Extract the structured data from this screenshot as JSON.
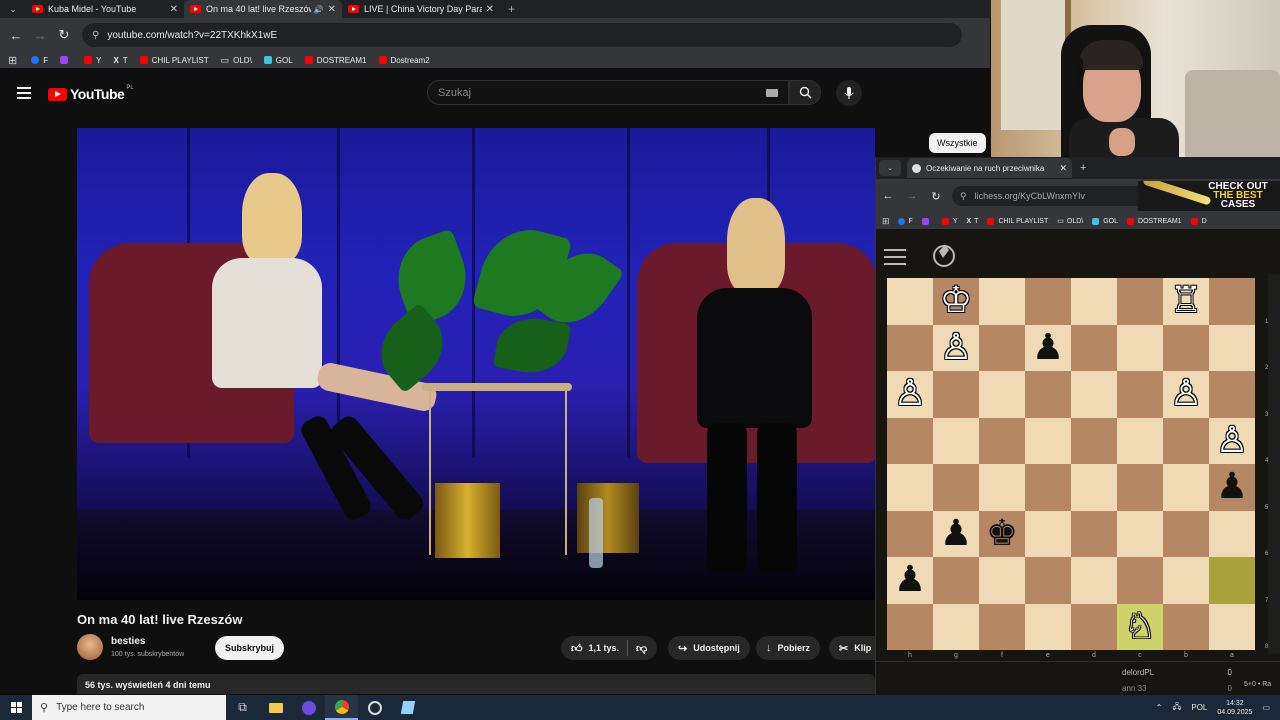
{
  "browser": {
    "tabs": [
      {
        "title": "Kuba Midel - YouTube",
        "active": false
      },
      {
        "title": "On ma 40 lat! live Rzeszów",
        "active": true
      },
      {
        "title": "LIVE | China Victory Day Parade",
        "active": false
      }
    ],
    "url": "youtube.com/watch?v=22TXKhkX1wE",
    "bookmarks": [
      {
        "label": "F",
        "color": "#1877f2"
      },
      {
        "label": "",
        "color": "#9146ff"
      },
      {
        "label": "Y",
        "color": "#ff0000"
      },
      {
        "label": "T",
        "color": "#ffffff"
      },
      {
        "label": "CHIL PLAYLIST",
        "color": "#ff0000"
      },
      {
        "label": "OLD\\",
        "color": "#888888"
      },
      {
        "label": "GOL",
        "color": "#3cc3e6"
      },
      {
        "label": "DOSTREAM1",
        "color": "#ff0000"
      },
      {
        "label": "Dostream2",
        "color": "#ff0000"
      }
    ]
  },
  "youtube": {
    "logo_text": "YouTube",
    "region": "PL",
    "search_placeholder": "Szukaj",
    "video_title": "On ma 40 lat! live Rzeszów",
    "channel_name": "besties",
    "channel_subs": "100 tys. subskrybentów",
    "subscribe_label": "Subskrybuj",
    "likes": "1,1 tys.",
    "share_label": "Udostępnij",
    "download_label": "Pobierz",
    "clip_label": "Klip",
    "views_line": "56 tys. wyświetleń  4 dni temu",
    "filter_chip": "Wszystkie"
  },
  "lichess": {
    "tab_title": "Oczekiwanie na ruch przeciwnika",
    "url": "lichess.org/KyCbLWnxmYIv",
    "ad_line1": "CHECK OUT",
    "ad_line2": "THE BEST",
    "ad_line3": "CASES",
    "bookmarks": [
      {
        "label": "F",
        "color": "#1877f2"
      },
      {
        "label": "",
        "color": "#9146ff"
      },
      {
        "label": "Y",
        "color": "#ff0000"
      },
      {
        "label": "T",
        "color": "#ffffff"
      },
      {
        "label": "CHIL PLAYLIST",
        "color": "#ff0000"
      },
      {
        "label": "OLD\\",
        "color": "#888888"
      },
      {
        "label": "GOL",
        "color": "#3cc3e6"
      },
      {
        "label": "DOSTREAM1",
        "color": "#ff0000"
      },
      {
        "label": "D",
        "color": "#ff0000"
      }
    ],
    "board": [
      [
        "",
        "wK",
        "",
        "",
        "",
        "",
        "wR",
        ""
      ],
      [
        "",
        "wP",
        "",
        "bP",
        "",
        "",
        "",
        ""
      ],
      [
        "wP",
        "",
        "",
        "",
        "",
        "",
        "wP",
        ""
      ],
      [
        "",
        "",
        "",
        "",
        "",
        "",
        "",
        "wP"
      ],
      [
        "",
        "",
        "",
        "",
        "",
        "",
        "",
        "bP"
      ],
      [
        "",
        "bP",
        "bK",
        "",
        "",
        "",
        "",
        ""
      ],
      [
        "bP",
        "",
        "",
        "",
        "",
        "",
        "",
        "hl"
      ],
      [
        "",
        "",
        "",
        "",
        "",
        "wN",
        "",
        ""
      ]
    ],
    "highlight_squares": [
      "r6c7",
      "r7c5"
    ],
    "files": [
      "h",
      "g",
      "f",
      "e",
      "d",
      "c",
      "b",
      "a"
    ],
    "ranks": [
      "1",
      "2",
      "3",
      "4",
      "5",
      "6",
      "7",
      "8"
    ],
    "player_name": "delordPL",
    "player_score": "0",
    "player_line2": "ann 33",
    "player_score2": "0",
    "time_control": "5+0 • Ra"
  },
  "taskbar": {
    "search_placeholder": "Type here to search",
    "lang": "POL",
    "time": "14:32",
    "date": "04.09.2025"
  }
}
